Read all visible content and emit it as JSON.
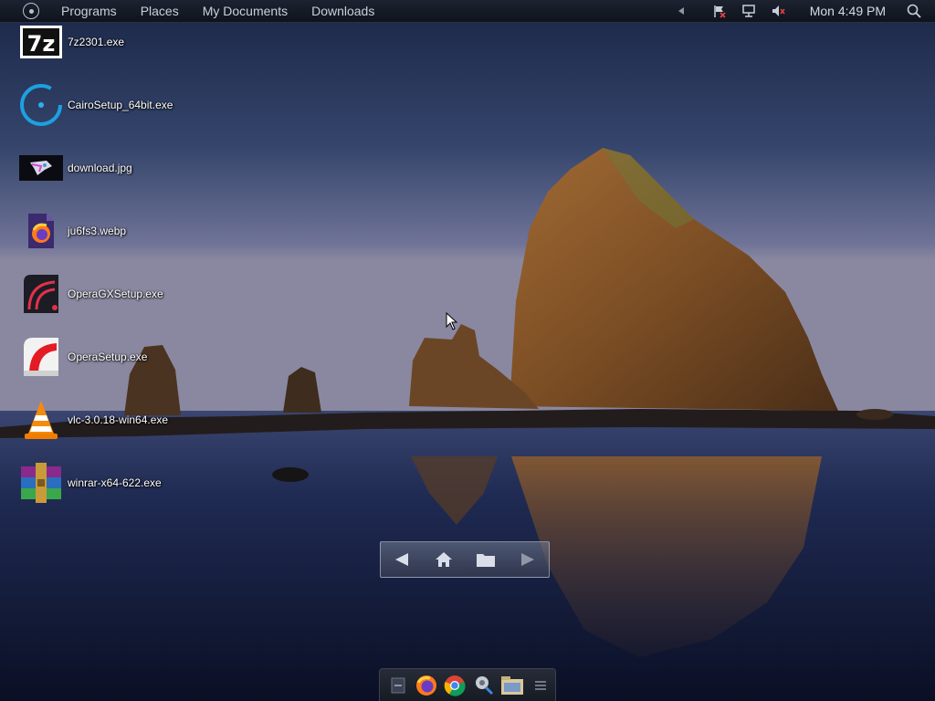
{
  "top_panel": {
    "menus": [
      "Programs",
      "Places",
      "My Documents",
      "Downloads"
    ],
    "clock": "Mon 4:49 PM"
  },
  "desktop": {
    "icons": [
      {
        "label": "7z2301.exe",
        "icon": "7zip-icon"
      },
      {
        "label": "CairoSetup_64bit.exe",
        "icon": "cairo-icon"
      },
      {
        "label": "download.jpg",
        "icon": "image-thumbnail-icon"
      },
      {
        "label": "ju6fs3.webp",
        "icon": "firefox-file-icon"
      },
      {
        "label": "OperaGXSetup.exe",
        "icon": "opera-gx-icon"
      },
      {
        "label": "OperaSetup.exe",
        "icon": "opera-icon"
      },
      {
        "label": "vlc-3.0.18-win64.exe",
        "icon": "vlc-icon"
      },
      {
        "label": "winrar-x64-622.exe",
        "icon": "winrar-icon"
      }
    ]
  },
  "nav_widget": {
    "buttons": [
      "back-arrow-icon",
      "home-icon",
      "folder-icon",
      "forward-arrow-icon"
    ]
  },
  "dock": {
    "items": [
      "show-desktop-icon",
      "firefox-icon",
      "chrome-icon",
      "settings-tool-icon",
      "file-manager-icon",
      "menu-icon"
    ]
  },
  "colors": {
    "panel": "#141925",
    "sky_top": "#1e2a4a",
    "sky_horizon": "#7a7c98",
    "rock": "#8a5a2c",
    "water": "#141a36"
  }
}
